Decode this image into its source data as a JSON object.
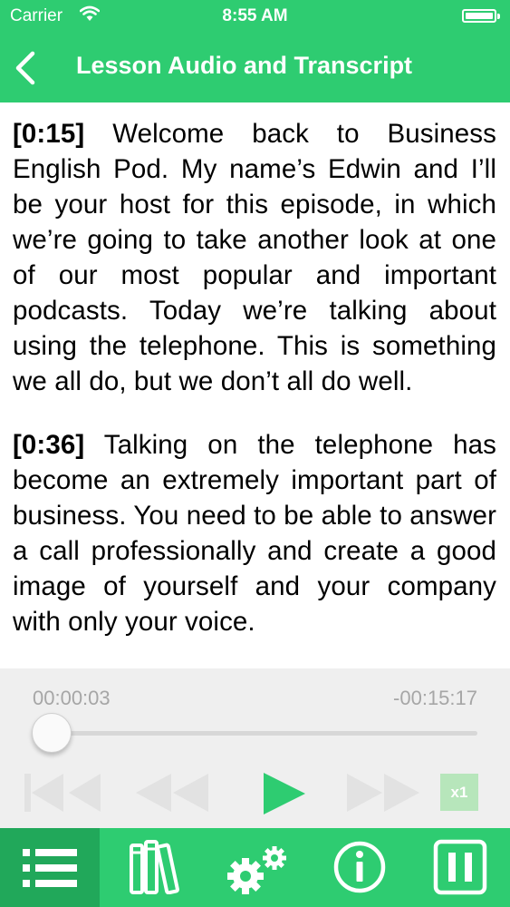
{
  "status_bar": {
    "carrier": "Carrier",
    "time": "8:55 AM"
  },
  "header": {
    "title": "Lesson Audio and Transcript",
    "back_icon": "chevron-left-icon"
  },
  "transcript": [
    {
      "timestamp": "[0:15]",
      "text": "Welcome back to Business English Pod. My name’s Edwin and I’ll be your host for this episode, in which we’re going to take another look at one of our most popular and important podcasts. Today we’re talking about using the telephone. This is something we all do, but we don’t all do well."
    },
    {
      "timestamp": "[0:36]",
      "text": "Talking on the telephone has become an extremely important part of business. You need to be able to answer a call professionally and create a good image of yourself and your company with only your voice."
    }
  ],
  "player": {
    "elapsed": "00:00:03",
    "remaining": "-00:15:17",
    "progress_fraction": 0.003,
    "speed": "x1",
    "controls": [
      "skip-back-icon",
      "rewind-icon",
      "play-icon",
      "fast-forward-icon"
    ]
  },
  "tabbar": {
    "items": [
      {
        "icon": "list-icon",
        "active": true
      },
      {
        "icon": "books-icon",
        "active": false
      },
      {
        "icon": "settings-gears-icon",
        "active": false
      },
      {
        "icon": "info-icon",
        "active": false
      },
      {
        "icon": "pause-icon",
        "active": false
      }
    ]
  },
  "colors": {
    "accent": "#2ecc71",
    "accent_dark": "#21a85a",
    "player_bg": "#efefef",
    "disabled_control": "#e2e2e2",
    "speed_badge": "#b7e6bb"
  }
}
